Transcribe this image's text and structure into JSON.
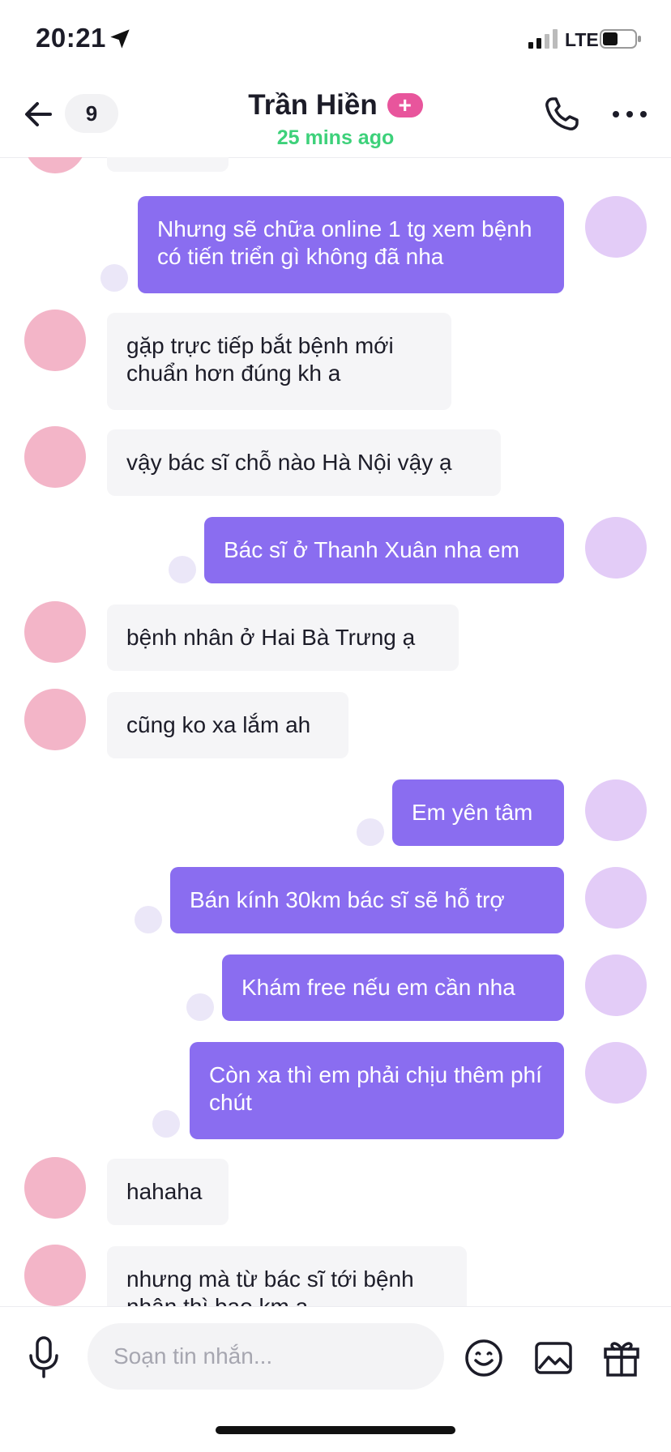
{
  "status_bar": {
    "time": "20:21",
    "network": "LTE"
  },
  "header": {
    "back_icon": "arrow-left-icon",
    "unread_count": "9",
    "contact_name": "Trần Hiền",
    "plus_badge": "+",
    "last_seen": "25 mins ago",
    "call_icon": "phone-icon",
    "more_icon": "more-horizontal-icon"
  },
  "messages": [
    {
      "direction": "outgoing",
      "text": "Nhưng sẽ chữa online 1 tg xem bệnh có tiến triển gì không đã nha"
    },
    {
      "direction": "incoming",
      "text": "gặp trực tiếp bắt bệnh mới chuẩn hơn đúng kh a"
    },
    {
      "direction": "incoming",
      "text": "vậy bác sĩ chỗ nào Hà Nội vậy ạ"
    },
    {
      "direction": "outgoing",
      "text": "Bác sĩ ở Thanh Xuân nha em"
    },
    {
      "direction": "incoming",
      "text": "bệnh nhân ở Hai Bà Trưng ạ"
    },
    {
      "direction": "incoming",
      "text": "cũng ko xa lắm ah"
    },
    {
      "direction": "outgoing",
      "text": "Em yên tâm"
    },
    {
      "direction": "outgoing",
      "text": "Bán kính 30km bác sĩ sẽ hỗ trợ"
    },
    {
      "direction": "outgoing",
      "text": "Khám free nếu em cần nha"
    },
    {
      "direction": "outgoing",
      "text": "Còn xa thì em phải chịu thêm phí chút"
    },
    {
      "direction": "incoming",
      "text": "hahaha"
    },
    {
      "direction": "incoming",
      "text": "nhưng mà từ bác sĩ tới bệnh nhân thì bao km a"
    }
  ],
  "composer": {
    "placeholder": "Soạn tin nhắn...",
    "mic_icon": "microphone-icon",
    "emoji_icon": "emoji-icon",
    "image_icon": "image-icon",
    "gift_icon": "gift-icon"
  },
  "colors": {
    "outgoing_bubble": "#8a6df0",
    "incoming_bubble": "#f5f5f7",
    "online_status": "#3dd17a",
    "plus_badge": "#e8559c"
  }
}
